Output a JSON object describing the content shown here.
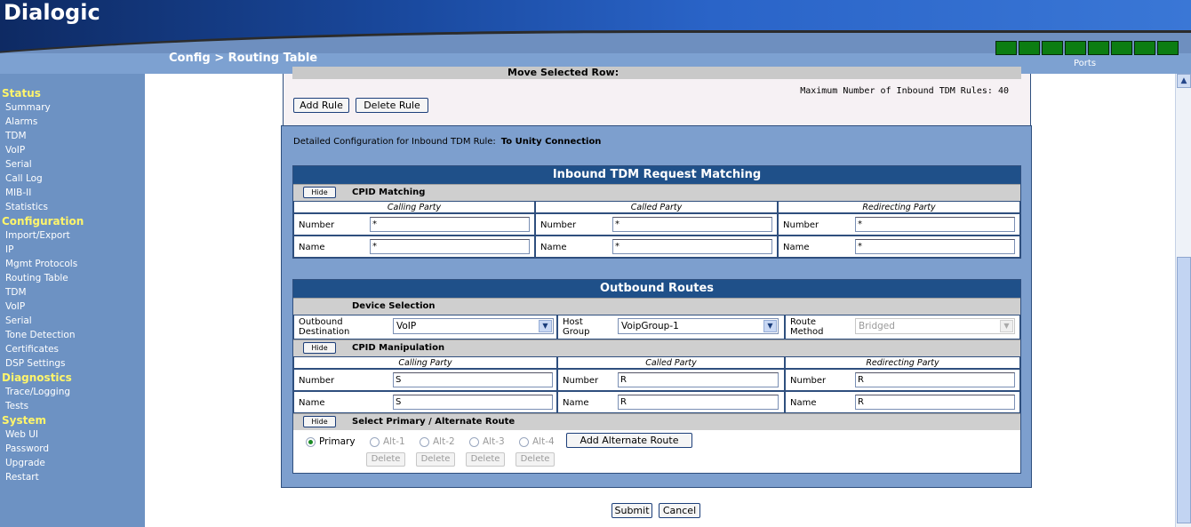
{
  "header": {
    "logo": "Dialogic",
    "breadcrumb": "Config > Routing Table",
    "ports_label": "Ports",
    "port_count": 8,
    "port_color": "#0c7d12"
  },
  "sidebar": [
    {
      "title": "Status",
      "items": [
        "Summary",
        "Alarms",
        "TDM",
        "VoIP",
        "Serial",
        "Call Log",
        "MIB-II",
        "Statistics"
      ]
    },
    {
      "title": "Configuration",
      "items": [
        "Import/Export",
        "IP",
        "Mgmt Protocols",
        "Routing Table",
        "TDM",
        "VoIP",
        "Serial",
        "Tone Detection",
        "Certificates",
        "DSP Settings"
      ]
    },
    {
      "title": "Diagnostics",
      "items": [
        "Trace/Logging",
        "Tests"
      ]
    },
    {
      "title": "System",
      "items": [
        "Web UI",
        "Password",
        "Upgrade",
        "Restart"
      ]
    }
  ],
  "top": {
    "move_label": "Move Selected Row:",
    "max_rules": "Maximum Number of Inbound TDM Rules: 40",
    "add_rule": "Add Rule",
    "delete_rule": "Delete Rule"
  },
  "detail": {
    "label": "Detailed Configuration for Inbound TDM Rule:",
    "rule_name": "To Unity Connection"
  },
  "inbound": {
    "title": "Inbound TDM Request Matching",
    "hide": "Hide",
    "cpid_label": "CPID Matching",
    "cols": [
      {
        "header": "Calling Party",
        "number_label": "Number",
        "number": "*",
        "name_label": "Name",
        "name": "*"
      },
      {
        "header": "Called Party",
        "number_label": "Number",
        "number": "*",
        "name_label": "Name",
        "name": "*"
      },
      {
        "header": "Redirecting Party",
        "number_label": "Number",
        "number": "*",
        "name_label": "Name",
        "name": "*"
      }
    ]
  },
  "outbound": {
    "title": "Outbound Routes",
    "device_label": "Device Selection",
    "dest_label_1": "Outbound",
    "dest_label_2": "Destination",
    "dest_value": "VoIP",
    "host_label_1": "Host",
    "host_label_2": "Group",
    "host_value": "VoipGroup-1",
    "method_label_1": "Route",
    "method_label_2": "Method",
    "method_value": "Bridged",
    "hide": "Hide",
    "manip_label": "CPID Manipulation",
    "cols": [
      {
        "header": "Calling Party",
        "number_label": "Number",
        "number": "S",
        "name_label": "Name",
        "name": "S"
      },
      {
        "header": "Called Party",
        "number_label": "Number",
        "number": "R",
        "name_label": "Name",
        "name": "R"
      },
      {
        "header": "Redirecting Party",
        "number_label": "Number",
        "number": "R",
        "name_label": "Name",
        "name": "R"
      }
    ],
    "route_label": "Select Primary / Alternate Route",
    "primary": "Primary",
    "alts": [
      "Alt-1",
      "Alt-2",
      "Alt-3",
      "Alt-4"
    ],
    "delete": "Delete",
    "add_alt": "Add Alternate Route"
  },
  "footer": {
    "submit": "Submit",
    "cancel": "Cancel"
  }
}
